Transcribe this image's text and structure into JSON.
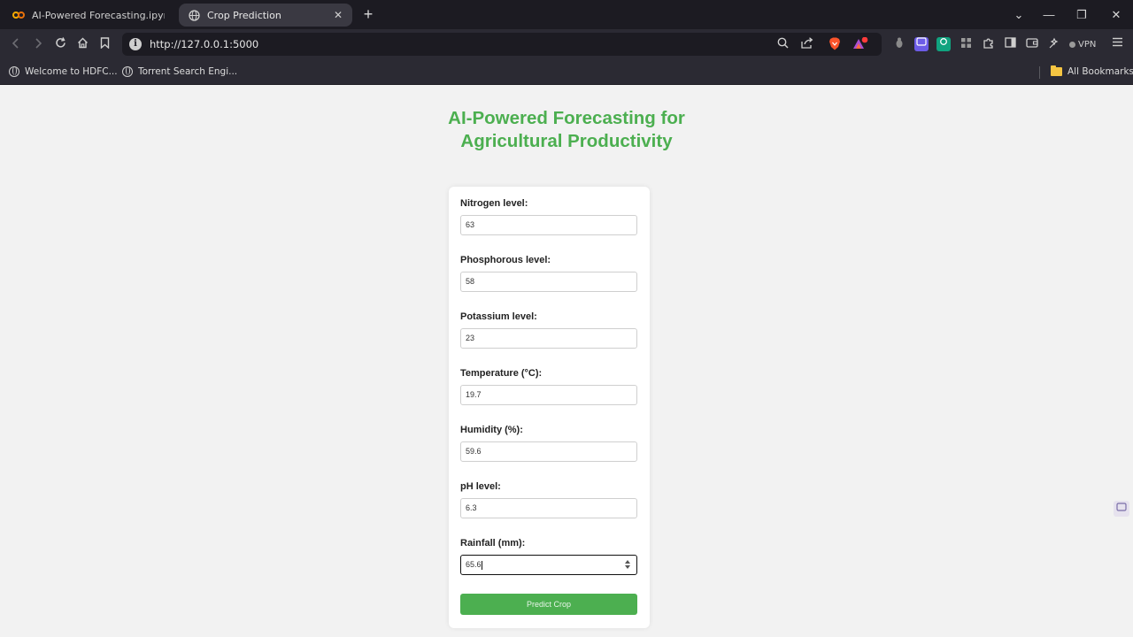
{
  "browser": {
    "tabs": [
      {
        "title": "AI-Powered Forecasting.ipynb - Col",
        "favicon": "colab-icon",
        "active": false
      },
      {
        "title": "Crop Prediction",
        "favicon": "globe-icon",
        "active": true
      }
    ],
    "new_tab_glyph": "+",
    "tab_close_glyph": "✕",
    "window_controls": {
      "tab_list": "⌄",
      "minimize": "—",
      "restore": "❐",
      "close": "✕"
    },
    "url": "http://127.0.0.1:5000",
    "vpn_label": "VPN",
    "bookmarks": [
      {
        "label": "Welcome to HDFC..."
      },
      {
        "label": "Torrent Search Engi..."
      }
    ],
    "all_bookmarks_label": "All Bookmarks"
  },
  "page": {
    "heading": "AI-Powered Forecasting for Agricultural Productivity",
    "fields": [
      {
        "label": "Nitrogen level:",
        "value": "63"
      },
      {
        "label": "Phosphorous level:",
        "value": "58"
      },
      {
        "label": "Potassium level:",
        "value": "23"
      },
      {
        "label": "Temperature (°C):",
        "value": "19.7"
      },
      {
        "label": "Humidity (%):",
        "value": "59.6"
      },
      {
        "label": "pH level:",
        "value": "6.3"
      },
      {
        "label": "Rainfall (mm):",
        "value": "65.6"
      }
    ],
    "submit_label": "Predict Crop"
  },
  "colors": {
    "accent_green": "#4caf50",
    "chrome_dark": "#1c1b22",
    "chrome_toolbar": "#2b2a33",
    "page_bg": "#f2f2f2"
  }
}
